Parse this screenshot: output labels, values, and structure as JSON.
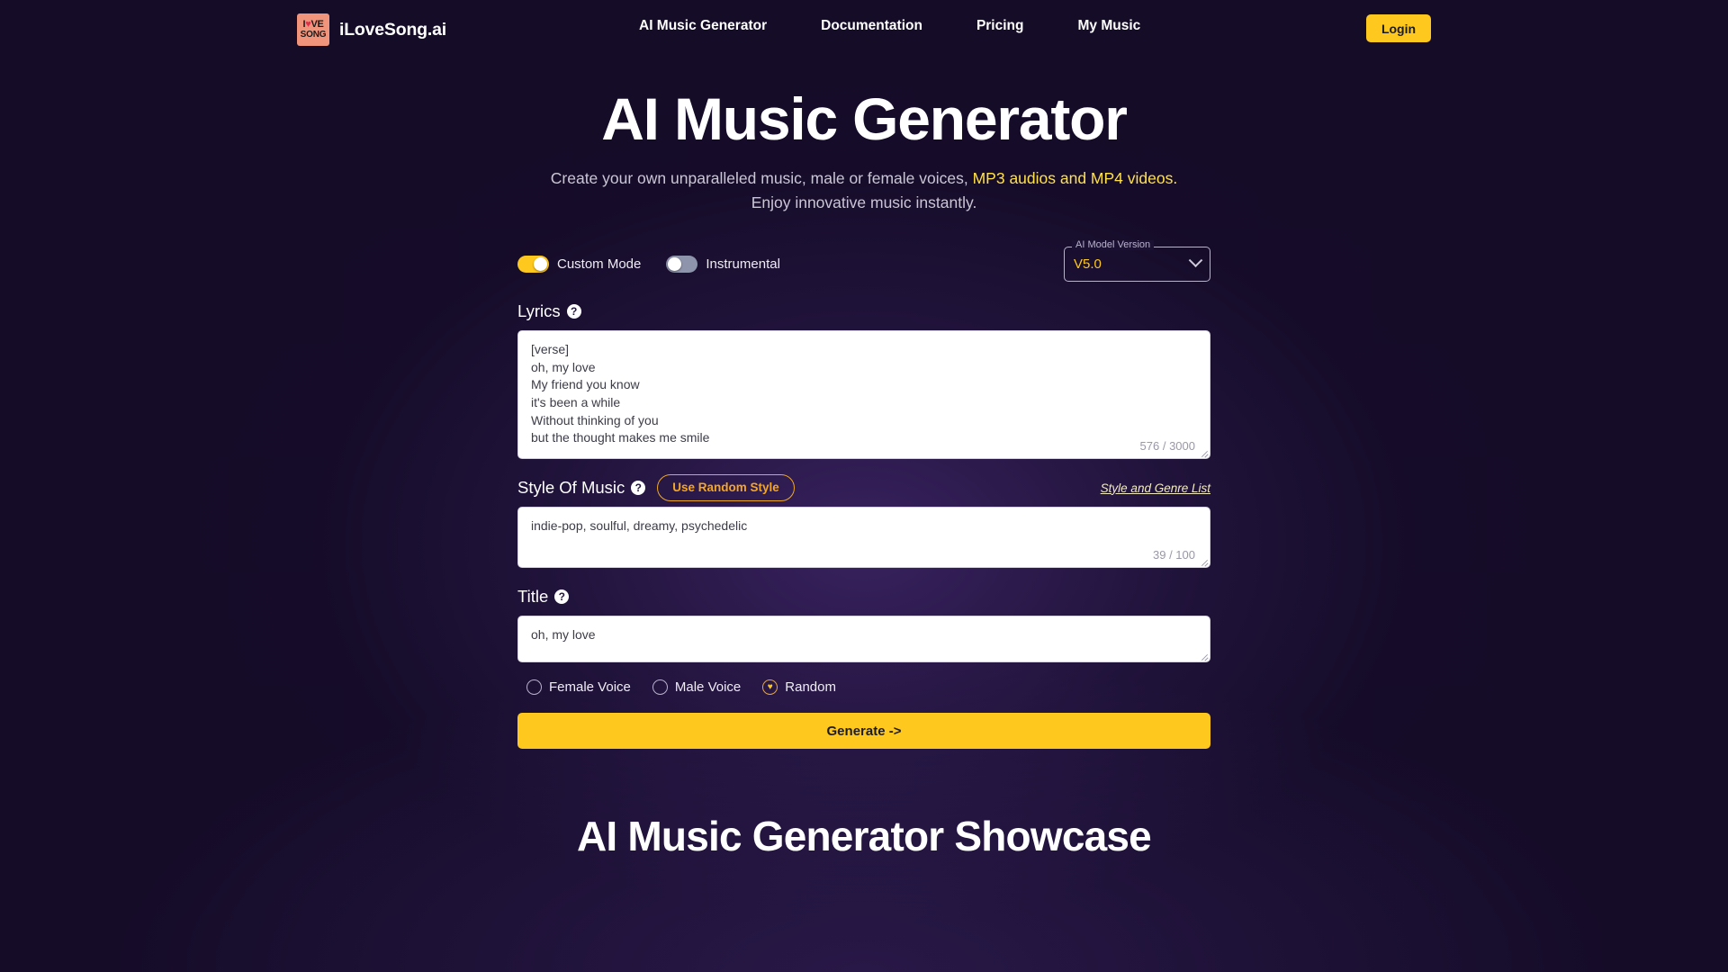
{
  "header": {
    "logo": {
      "line1_pre": "I",
      "line1_heart": "♥",
      "line1_post": "VE",
      "line2": "SONG",
      "icon": "ilovesong-logo-icon"
    },
    "brand_name": "iLoveSong.ai",
    "nav": [
      {
        "label": "AI Music Generator"
      },
      {
        "label": "Documentation"
      },
      {
        "label": "Pricing"
      },
      {
        "label": "My Music"
      }
    ],
    "login_label": "Login"
  },
  "hero": {
    "title": "AI Music Generator",
    "subtitle_part1": "Create your own unparalleled music, male or female voices, ",
    "subtitle_highlight": "MP3 audios and MP4 videos.",
    "subtitle_line2": "Enjoy innovative music instantly."
  },
  "form": {
    "custom_mode": {
      "label": "Custom Mode",
      "state": "on"
    },
    "instrumental": {
      "label": "Instrumental",
      "state": "off"
    },
    "model_select": {
      "legend": "AI Model Version",
      "value": "V5.0",
      "icon": "chevron-down-icon"
    },
    "lyrics": {
      "label": "Lyrics",
      "help_glyph": "?",
      "value": "[verse]\noh, my love\nMy friend you know\nit's been a while\nWithout thinking of you\nbut the thought makes me smile",
      "counter": "576 / 3000"
    },
    "style": {
      "label": "Style Of Music",
      "help_glyph": "?",
      "random_button": "Use Random Style",
      "genre_link": "Style and Genre List",
      "value": "indie-pop, soulful, dreamy, psychedelic",
      "counter": "39 / 100"
    },
    "title_field": {
      "label": "Title",
      "help_glyph": "?",
      "value": "oh, my love"
    },
    "voice_options": [
      {
        "label": "Female Voice",
        "selected": false
      },
      {
        "label": "Male Voice",
        "selected": false
      },
      {
        "label": "Random",
        "selected": true,
        "glyph": "♥"
      }
    ],
    "generate_label": "Generate ->"
  },
  "showcase": {
    "title": "AI Music Generator Showcase"
  },
  "colors": {
    "accent_yellow": "#ffc81e",
    "background": "#150c28",
    "logo_salmon": "#f0947c",
    "heart_red": "#e0314b"
  }
}
